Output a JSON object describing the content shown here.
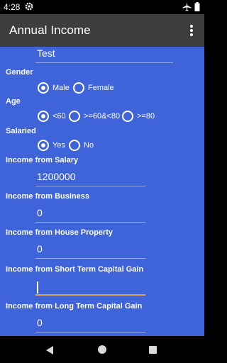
{
  "status": {
    "time": "4:28"
  },
  "app_bar": {
    "title": "Annual Income"
  },
  "form": {
    "name_value": "Test",
    "gender": {
      "label": "Gender",
      "options": [
        "Male",
        "Female"
      ],
      "selected": "Male"
    },
    "age": {
      "label": "Age",
      "options": [
        "<60",
        ">=60&<80",
        ">=80"
      ],
      "selected": "<60"
    },
    "salaried": {
      "label": "Salaried",
      "options": [
        "Yes",
        "No"
      ],
      "selected": "Yes"
    },
    "salary": {
      "label": "Income from Salary",
      "value": "1200000"
    },
    "business": {
      "label": "Income from Business",
      "value": "0"
    },
    "house": {
      "label": "Income from House Property",
      "value": "0"
    },
    "stcg": {
      "label": "Income from Short Term Capital Gain",
      "value": ""
    },
    "ltcg": {
      "label": "Income from Long Term Capital Gain",
      "value": "0"
    }
  },
  "colors": {
    "form_bg": "#3f63d8",
    "app_bar": "#3d3d3d",
    "focus_underline": "#d8a65a"
  },
  "icons": [
    "settings-gear-icon",
    "airplane-mode-icon",
    "battery-icon",
    "overflow-menu-icon",
    "back-icon",
    "home-icon",
    "recents-icon"
  ]
}
